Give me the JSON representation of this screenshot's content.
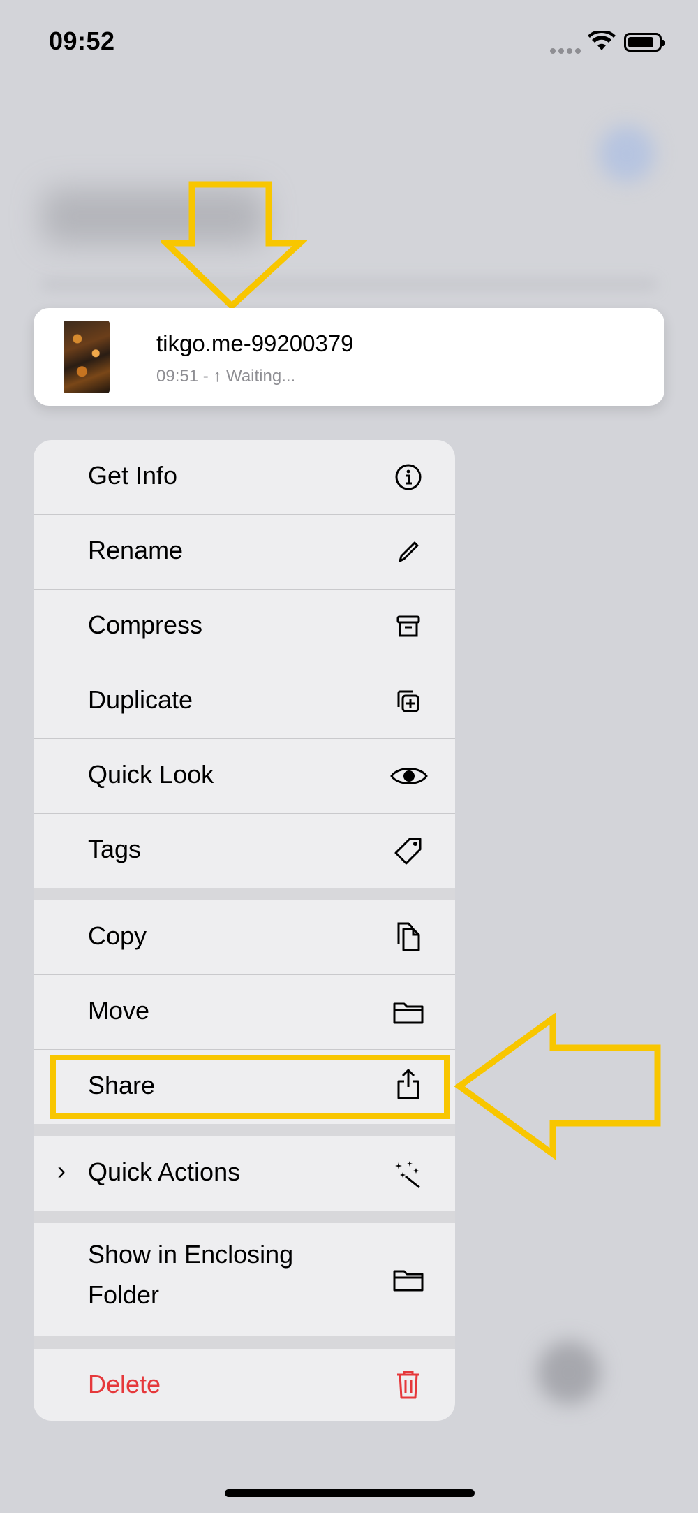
{
  "status_bar": {
    "time": "09:52"
  },
  "file": {
    "name": "tikgo.me-99200379",
    "meta": "09:51 - ↑ Waiting..."
  },
  "menu": {
    "get_info": "Get Info",
    "rename": "Rename",
    "compress": "Compress",
    "duplicate": "Duplicate",
    "quick_look": "Quick Look",
    "tags": "Tags",
    "copy": "Copy",
    "move": "Move",
    "share": "Share",
    "quick_actions": "Quick Actions",
    "show_in_folder_line1": "Show in Enclosing",
    "show_in_folder_line2": "Folder",
    "delete": "Delete"
  },
  "colors": {
    "annotation": "#f8c600",
    "destructive": "#e5383b"
  }
}
